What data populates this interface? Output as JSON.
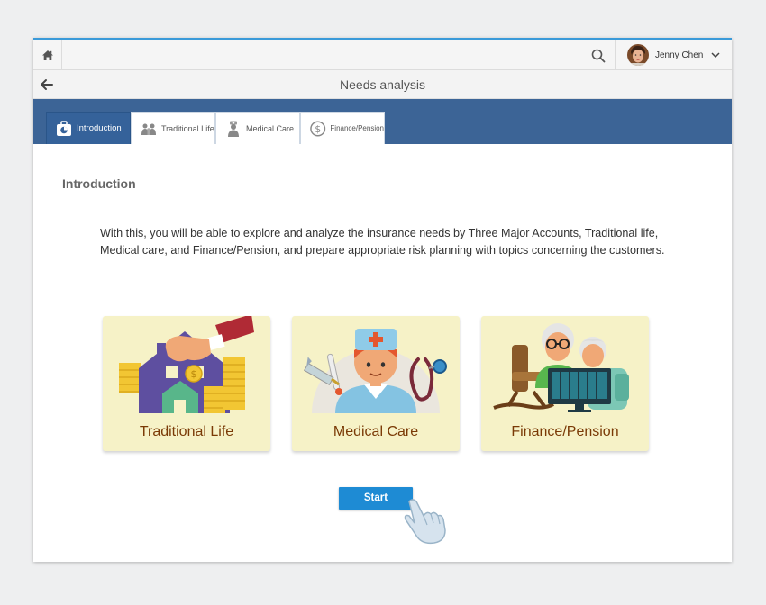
{
  "header": {
    "user_name": "Jenny Chen"
  },
  "titlebar": {
    "title": "Needs analysis"
  },
  "tabs": [
    {
      "label": "Introduction",
      "active": true
    },
    {
      "label": "Traditional Life",
      "active": false
    },
    {
      "label": "Medical Care",
      "active": false
    },
    {
      "label": "Finance/Pension",
      "active": false
    }
  ],
  "main": {
    "section_title": "Introduction",
    "intro_text": "With this, you will be able to explore and analyze the insurance needs by Three Major Accounts, Traditional life, Medical care, and Finance/Pension, and prepare appropriate risk planning with topics concerning the customers.",
    "cards": [
      {
        "label": "Traditional Life"
      },
      {
        "label": "Medical Care"
      },
      {
        "label": "Finance/Pension"
      }
    ],
    "start_label": "Start"
  },
  "colors": {
    "accent": "#1e8bd4",
    "tab_bar": "#3c6496",
    "card_bg": "#f6f2c7",
    "card_text": "#7a3a06"
  },
  "icons": [
    "home-icon",
    "search-icon",
    "chevron-down-icon",
    "back-arrow-icon",
    "pointing-hand-icon"
  ]
}
